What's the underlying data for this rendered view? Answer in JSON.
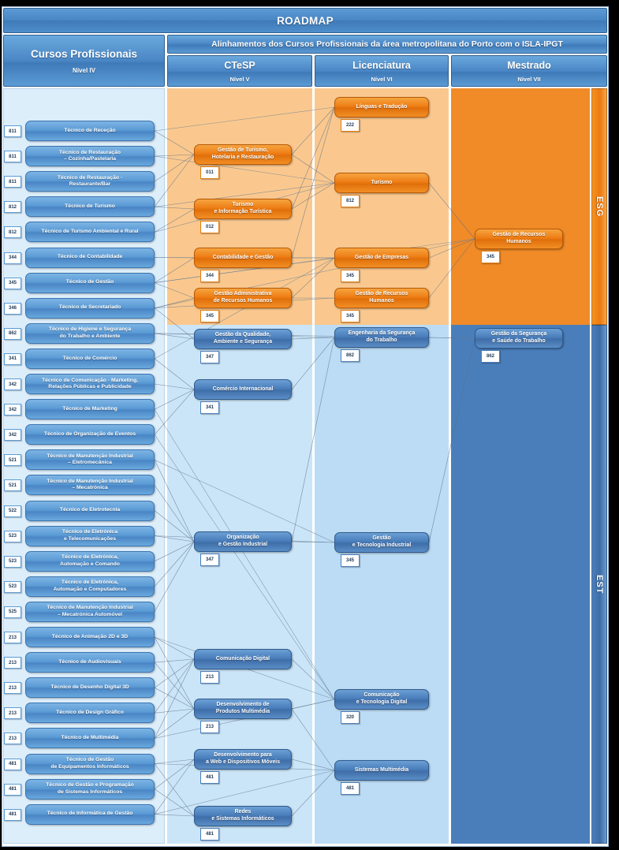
{
  "header": {
    "roadmap_title": "ROADMAP",
    "left_title": "Cursos Profissionais",
    "left_level": "Nível IV",
    "alignment_title": "Alinhamentos dos Cursos Profissionais da área metropolitana do Porto com o ISLA-IPGT",
    "columns": [
      {
        "label": "CTeSP",
        "level": "Nível V"
      },
      {
        "label": "Licenciatura",
        "level": "Nível VI"
      },
      {
        "label": "Mestrado",
        "level": "Nível VII"
      }
    ]
  },
  "rails": [
    {
      "label": "ESG",
      "color": "#f0891f"
    },
    {
      "label": "EST",
      "color": "#4a7ebb"
    }
  ],
  "colors": {
    "header_blue": "#4a86c5",
    "orange_box": "#ee7d15",
    "blue_box": "#4a7ebb",
    "esg_band": "#fac88e",
    "est_band": "#cbe5f8",
    "left_band": "#ddeefb",
    "course_box": "#5b9bd5"
  },
  "courses": [
    {
      "code": "811",
      "line1": "Técnico de Receção",
      "line2": ""
    },
    {
      "code": "811",
      "line1": "Técnico de Restauração",
      "line2": "– Cozinha/Pastelaria"
    },
    {
      "code": "811",
      "line1": "Técnico de Restauração -",
      "line2": "Restaurante/Bar"
    },
    {
      "code": "812",
      "line1": "Técnico de Turismo",
      "line2": ""
    },
    {
      "code": "812",
      "line1": "Técnico de Turismo Ambiental e Rural",
      "line2": ""
    },
    {
      "code": "344",
      "line1": "Técnico de Contabilidade",
      "line2": ""
    },
    {
      "code": "345",
      "line1": "Técnico de Gestão",
      "line2": ""
    },
    {
      "code": "346",
      "line1": "Técnico de Secretariado",
      "line2": ""
    },
    {
      "code": "862",
      "line1": "Técnico de Higiene e Segurança",
      "line2": "do Trabalho e Ambiente"
    },
    {
      "code": "341",
      "line1": "Técnico de Comércio",
      "line2": ""
    },
    {
      "code": "342",
      "line1": "Técnico de Comunicação - Marketing,",
      "line2": "Relações Públicas e Publicidade"
    },
    {
      "code": "342",
      "line1": "Técnico de Marketing",
      "line2": ""
    },
    {
      "code": "342",
      "line1": "Técnico de Organização de Eventos",
      "line2": ""
    },
    {
      "code": "521",
      "line1": "Técnico de Manutenção Industrial",
      "line2": "– Eletromecânica"
    },
    {
      "code": "521",
      "line1": "Técnico de Manutenção Industrial",
      "line2": "– Mecatrónica"
    },
    {
      "code": "522",
      "line1": "Técnico de Eletrotecnia",
      "line2": ""
    },
    {
      "code": "523",
      "line1": "Técnico de Eletrónica",
      "line2": "e Telecomunicações"
    },
    {
      "code": "523",
      "line1": "Técnico de Eletrónica,",
      "line2": "Automação e Comando"
    },
    {
      "code": "523",
      "line1": "Técnico de Eletrónica,",
      "line2": "Automação e Computadores"
    },
    {
      "code": "525",
      "line1": "Técnico de Manutenção Industrial",
      "line2": "– Mecatrónica Automóvel"
    },
    {
      "code": "213",
      "line1": "Técnico de Animação 2D e 3D",
      "line2": ""
    },
    {
      "code": "213",
      "line1": "Técnico de Audiovisuais",
      "line2": ""
    },
    {
      "code": "213",
      "line1": "Técnico de Desenho Digital 3D",
      "line2": ""
    },
    {
      "code": "213",
      "line1": "Técnico de Design Gráfico",
      "line2": ""
    },
    {
      "code": "213",
      "line1": "Técnico de Multimédia",
      "line2": ""
    },
    {
      "code": "481",
      "line1": "Técnico de Gestão",
      "line2": "de Equipamentos Informáticos"
    },
    {
      "code": "481",
      "line1": "Técnico de Gestão e Programação",
      "line2": "de Sistemas Informáticos"
    },
    {
      "code": "481",
      "line1": "Técnico de Informática de Gestão",
      "line2": ""
    }
  ],
  "ctesp": [
    {
      "code": "011",
      "line1": "Gestão de Turismo,",
      "line2": "Hotelaria e Restauração",
      "school": "ESG"
    },
    {
      "code": "012",
      "line1": "Turismo",
      "line2": "e Informação Turística",
      "school": "ESG"
    },
    {
      "code": "344",
      "line1": "Contabilidade e Gestão",
      "line2": "",
      "school": "ESG"
    },
    {
      "code": "345",
      "line1": "Gestão Administrativa",
      "line2": "de Recursos Humanos",
      "school": "ESG"
    },
    {
      "code": "347",
      "line1": "Gestão da Qualidade,",
      "line2": "Ambiente e Segurança",
      "school": "EST"
    },
    {
      "code": "341",
      "line1": "Comércio Internacional",
      "line2": "",
      "school": "EST"
    },
    {
      "code": "347",
      "line1": "Organização",
      "line2": "e Gestão Industrial",
      "school": "EST"
    },
    {
      "code": "213",
      "line1": "Comunicação Digital",
      "line2": "",
      "school": "EST"
    },
    {
      "code": "213",
      "line1": "Desenvolvimento de",
      "line2": "Produtos Multimédia",
      "school": "EST"
    },
    {
      "code": "481",
      "line1": "Desenvolvimento para",
      "line2": "a Web e Dispositivos Móveis",
      "school": "EST"
    },
    {
      "code": "481",
      "line1": "Redes",
      "line2": "e Sistemas Informáticos",
      "school": "EST"
    }
  ],
  "licenciatura": [
    {
      "code": "222",
      "line1": "Línguas e Tradução",
      "line2": "",
      "school": "ESG"
    },
    {
      "code": "812",
      "line1": "Turismo",
      "line2": "",
      "school": "ESG"
    },
    {
      "code": "345",
      "line1": "Gestão de Empresas",
      "line2": "",
      "school": "ESG"
    },
    {
      "code": "345",
      "line1": "Gestão de Recursos",
      "line2": "Humanos",
      "school": "ESG"
    },
    {
      "code": "862",
      "line1": "Engenharia da Segurança",
      "line2": "do Trabalho",
      "school": "EST"
    },
    {
      "code": "345",
      "line1": "Gestão",
      "line2": "e Tecnologia Industrial",
      "school": "EST"
    },
    {
      "code": "320",
      "line1": "Comunicação",
      "line2": "e Tecnologia Digital",
      "school": "EST"
    },
    {
      "code": "481",
      "line1": "Sistemas Multimédia",
      "line2": "",
      "school": "EST"
    }
  ],
  "mestrado": [
    {
      "code": "345",
      "line1": "Gestão de Recursos",
      "line2": "Humanos",
      "school": "ESG"
    },
    {
      "code": "862",
      "line1": "Gestão da Segurança",
      "line2": "e Saúde do Trabalho",
      "school": "EST"
    }
  ]
}
